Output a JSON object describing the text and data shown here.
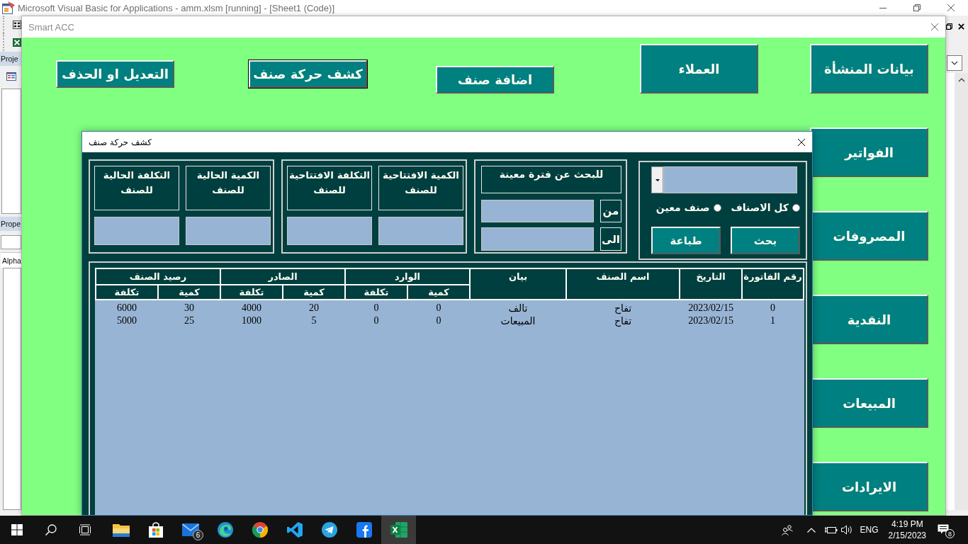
{
  "vba_window": {
    "title": "Microsoft Visual Basic for Applications - amm.xlsm [running] - [Sheet1 (Code)]",
    "project_panel": "Proje",
    "properties_panel": "Prope",
    "properties_tab": "Alpha"
  },
  "form": {
    "title": "Smart ACC",
    "top_buttons": [
      {
        "label": "العملاء",
        "focused": false
      },
      {
        "label": "اضافة صنف",
        "focused": false
      },
      {
        "label": "كشف حركة صنف",
        "focused": true
      },
      {
        "label": "التعديل او الحذف",
        "focused": false
      }
    ],
    "side_buttons": [
      {
        "label": "بيانات المنشأة",
        "focused": false
      },
      {
        "label": "الفواتير",
        "focused": false
      },
      {
        "label": "المصروفات",
        "focused": false
      },
      {
        "label": "النقدية",
        "focused": false
      },
      {
        "label": "المبيعات",
        "focused": false
      },
      {
        "label": "الايرادات",
        "focused": false
      }
    ]
  },
  "dialog": {
    "title": "كشف حركة صنف",
    "item_filter": {
      "options": [
        {
          "label": "كل الاصناف",
          "selected": false
        },
        {
          "label": "صنف معين",
          "selected": false
        }
      ],
      "buttons": [
        "بحث",
        "طباعة"
      ]
    },
    "period": {
      "title": "للبحث عن فترة معينة",
      "fields": [
        {
          "label": "من"
        },
        {
          "label": "الى"
        }
      ]
    },
    "totals": [
      {
        "fields": [
          {
            "label": "الكمية الافتتاحية للصنف"
          },
          {
            "label": "التكلفة الافتتاحية للصنف"
          }
        ]
      },
      {
        "fields": [
          {
            "label": "الكمية الحالية للصنف"
          },
          {
            "label": "التكلفة الحالية للصنف"
          }
        ]
      }
    ],
    "table": {
      "columns": [
        {
          "label": "رقم الفاتورة"
        },
        {
          "label": "التاريخ"
        },
        {
          "label": "اسم الصنف"
        },
        {
          "label": "بيان"
        },
        {
          "label": "الوارد",
          "colspan": 2,
          "sub": [
            "كمية",
            "تكلفة"
          ]
        },
        {
          "label": "الصادر",
          "colspan": 2,
          "sub": [
            "كمية",
            "تكلفة"
          ]
        },
        {
          "label": "رصيد الصنف",
          "colspan": 2,
          "sub": [
            "كمية",
            "تكلفة"
          ]
        }
      ],
      "rows": [
        [
          "0",
          "2023/02/15",
          "تفاح",
          "تالف",
          "0",
          "0",
          "20",
          "4000",
          "30",
          "6000"
        ],
        [
          "1",
          "2023/02/15",
          "تفاح",
          "المبيعات",
          "0",
          "0",
          "5",
          "1000",
          "25",
          "5000"
        ]
      ]
    }
  },
  "taskbar": {
    "apps": [
      {
        "active": false
      },
      {
        "active": false
      },
      {
        "active": false,
        "badge": "6"
      },
      {
        "active": false
      },
      {
        "active": false
      },
      {
        "active": false
      },
      {
        "active": false
      },
      {
        "active": false
      },
      {
        "active": true
      }
    ],
    "language": "ENG",
    "time": "4:19 PM",
    "date": "2/15/2023",
    "notifications": "8"
  }
}
